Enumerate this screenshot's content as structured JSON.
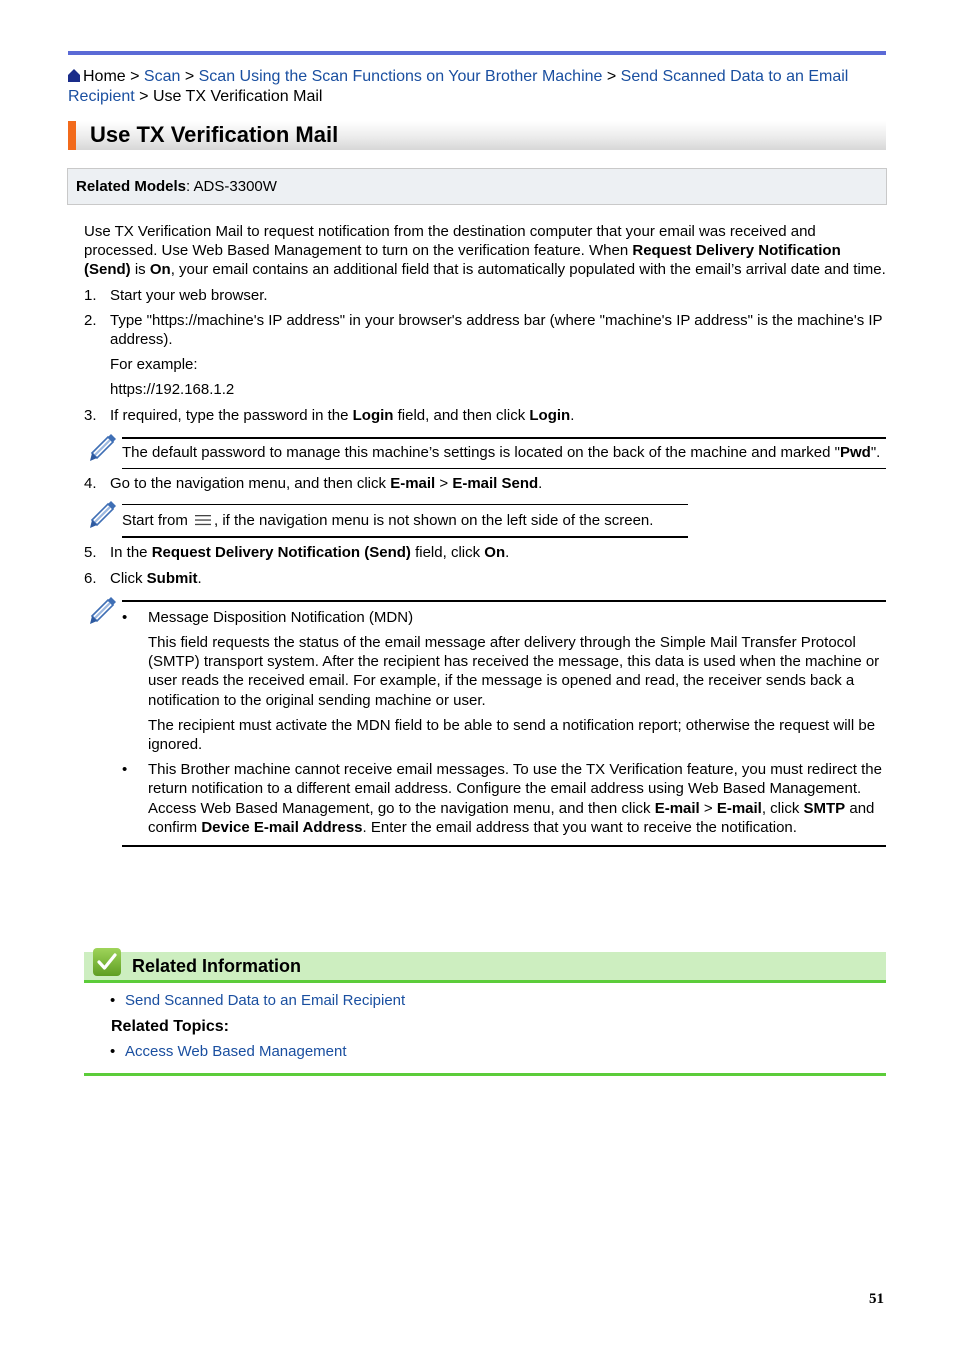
{
  "colors": {
    "top_rule": "#5b6ad6",
    "title_accent": "#f26a1b",
    "link": "#1a4fa0",
    "related_bg": "#cdeec0",
    "related_rule": "#5ccc3a",
    "models_bg": "#edf0f3"
  },
  "breadcrumb": {
    "icon": "home-icon",
    "home": "Home",
    "separator": " > ",
    "links": [
      "Scan",
      "Scan Using the Scan Functions on Your Brother Machine",
      "Send Scanned Data to an Email Recipient"
    ],
    "current": "Use TX Verification Mail"
  },
  "page_title": "Use TX Verification Mail",
  "related_models": {
    "label": "Related Models",
    "separator": ": ",
    "value": "ADS-3300W"
  },
  "intro": {
    "t1": "Use TX Verification Mail to request notification from the destination computer that your email was received and processed. Use Web Based Management to turn on the verification feature. When ",
    "b1": "Request Delivery Notification (Send)",
    "t2": " is ",
    "b2": "On",
    "t3": ", your email contains an additional field that is automatically populated with the email’s arrival date and time."
  },
  "steps": [
    {
      "num": "1.",
      "text": "Start your web browser."
    },
    {
      "num": "2.",
      "text": "Type \"https://machine's IP address\" in your browser's address bar (where \"machine's IP address\" is the machine's IP address).",
      "sub1": "For example:",
      "sub2": "https://192.168.1.2"
    },
    {
      "num": "3.",
      "t1": "If required, type the password in the ",
      "b1": "Login",
      "t2": " field, and then click ",
      "b2": "Login",
      "t3": "."
    },
    {
      "num": "4.",
      "t1": "Go to the navigation menu, and then click ",
      "b1": "E-mail",
      "t2": " > ",
      "b2": "E-mail Send",
      "t3": "."
    },
    {
      "num": "5.",
      "t1": "In the ",
      "b1": "Request Delivery Notification (Send)",
      "t2": " field, click ",
      "b2": "On",
      "t3": "."
    },
    {
      "num": "6.",
      "t1": "Click ",
      "b1": "Submit",
      "t2": "."
    }
  ],
  "notes": {
    "password": {
      "icon": "pencil-icon",
      "t1": "The default password to manage this machine’s settings is located on the back of the machine and marked \"",
      "b1": "Pwd",
      "t2": "\"."
    },
    "menu": {
      "icon": "pencil-icon",
      "t1": "Start from ",
      "menu_icon": "hamburger-menu-icon",
      "t2": ", if the navigation menu is not shown on the left side of the screen."
    },
    "mdn": {
      "icon": "pencil-icon",
      "bullet": "•",
      "item1": {
        "title": "Message Disposition Notification (MDN)",
        "p1": "This field requests the status of the email message after delivery through the Simple Mail Transfer Protocol (SMTP) transport system. After the recipient has received the message, this data is used when the machine or user reads the received email. For example, if the message is opened and read, the receiver sends back a notification to the original sending machine or user.",
        "p2": "The recipient must activate the MDN field to be able to send a notification report; otherwise the request will be ignored."
      },
      "item2": {
        "t1": "This Brother machine cannot receive email messages. To use the TX Verification feature, you must redirect the return notification to a different email address. Configure the email address using Web Based Management. Access Web Based Management, go to the navigation menu, and then click ",
        "b1": "E-mail",
        "t2": " > ",
        "b2": "E-mail",
        "t3": ", click ",
        "b3": "SMTP",
        "t4": " and confirm ",
        "b4": "Device E-mail Address",
        "t5": ". Enter the email address that you want to receive the notification."
      }
    }
  },
  "related_information": {
    "icon": "checkmark-icon",
    "title": "Related Information",
    "bullet": "•",
    "links": [
      "Send Scanned Data to an Email Recipient"
    ],
    "topics_label": "Related Topics:",
    "topics": [
      "Access Web Based Management"
    ]
  },
  "page_number": "51"
}
